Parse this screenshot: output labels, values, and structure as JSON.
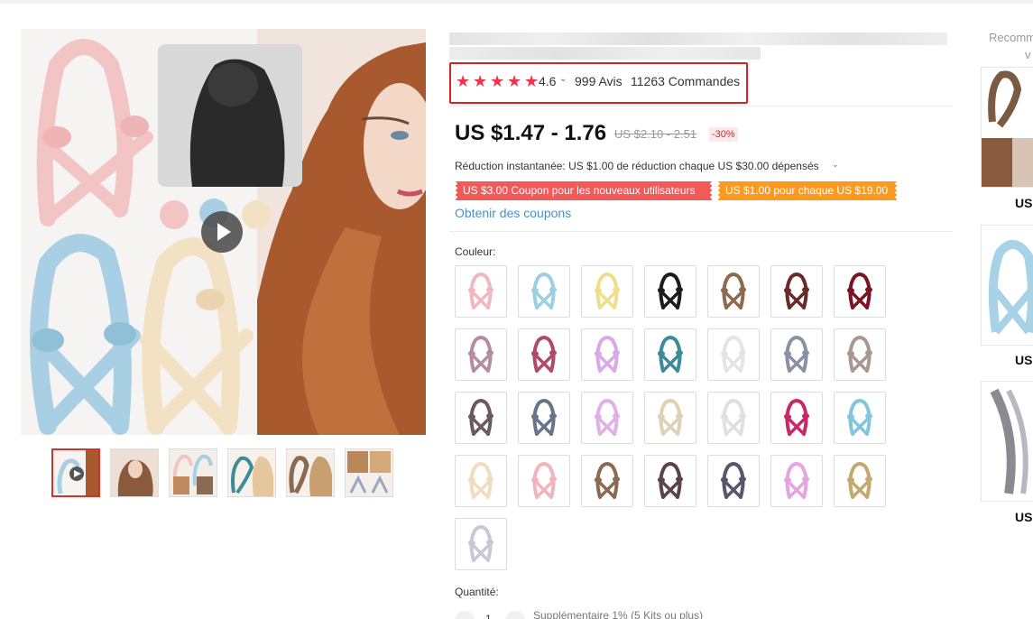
{
  "product": {
    "rating": {
      "stars": 5,
      "value": "4.6",
      "reviews": "999 Avis",
      "orders": "11263 Commandes"
    },
    "price": "US $1.47 - 1.76",
    "old_price": "US $2.10 - 2.51",
    "discount": "-30%",
    "reduction": "Réduction instantanée: US $1.00 de réduction chaque US $30.00 dépensés",
    "coupons": [
      "US $3.00 Coupon pour les nouveaux utilisateurs",
      "US $1.00 pour chaque US $19.00"
    ],
    "get_coupons": "Obtenir des coupons",
    "color_label": "Couleur:",
    "swatches": [
      {
        "color": "#f2b8c0"
      },
      {
        "color": "#9ccfe0"
      },
      {
        "color": "#efdf8a"
      },
      {
        "color": "#1c1c1c"
      },
      {
        "color": "#8c6a4e"
      },
      {
        "color": "#6a2a2a"
      },
      {
        "color": "#7a1424"
      },
      {
        "color": "#b48ea0"
      },
      {
        "color": "#b04a6c"
      },
      {
        "color": "#d8a8e8"
      },
      {
        "color": "#3d8a98"
      },
      {
        "color": "#e4e4e4"
      },
      {
        "color": "#8a90a6"
      },
      {
        "color": "#a89890"
      },
      {
        "color": "#6d5a5c"
      },
      {
        "color": "#6a7488"
      },
      {
        "color": "#e0b0e6"
      },
      {
        "color": "#ddd2b8"
      },
      {
        "color": "#e0e0e0"
      },
      {
        "color": "#c8286a"
      },
      {
        "color": "#84c4dc"
      },
      {
        "color": "#f0dcc0"
      },
      {
        "color": "#f2b4bc"
      },
      {
        "color": "#8a6a52"
      },
      {
        "color": "#5a4446"
      },
      {
        "color": "#56586a"
      },
      {
        "color": "#e6a4e0"
      },
      {
        "color": "#c4a870"
      },
      {
        "color": "#c8c8d8"
      }
    ],
    "quantity_label": "Quantité:",
    "quantity_value": "1",
    "bulk_note": "Supplémentaire 1% (5 Kits ou plus)"
  },
  "thumbnails": [
    {
      "name": "thumbnail-1",
      "color": "#f3c4c4"
    },
    {
      "name": "thumbnail-2",
      "color": "#b9876a"
    },
    {
      "name": "thumbnail-3",
      "color": "#e9d7c9"
    },
    {
      "name": "thumbnail-4",
      "color": "#d8b98a"
    },
    {
      "name": "thumbnail-5",
      "color": "#b58a5c"
    },
    {
      "name": "thumbnail-6",
      "color": "#c99a6a"
    }
  ],
  "recommendations": {
    "title": "Recomm",
    "title_line2": "v",
    "items": [
      {
        "price": "US"
      },
      {
        "price": "US"
      },
      {
        "price": "US"
      }
    ]
  },
  "colors": {
    "accent_red": "#e02020",
    "star_red": "#f5314b",
    "link_blue": "#4a90c8",
    "coupon_red": "#f25a5a",
    "coupon_orange": "#fb9a1e"
  }
}
